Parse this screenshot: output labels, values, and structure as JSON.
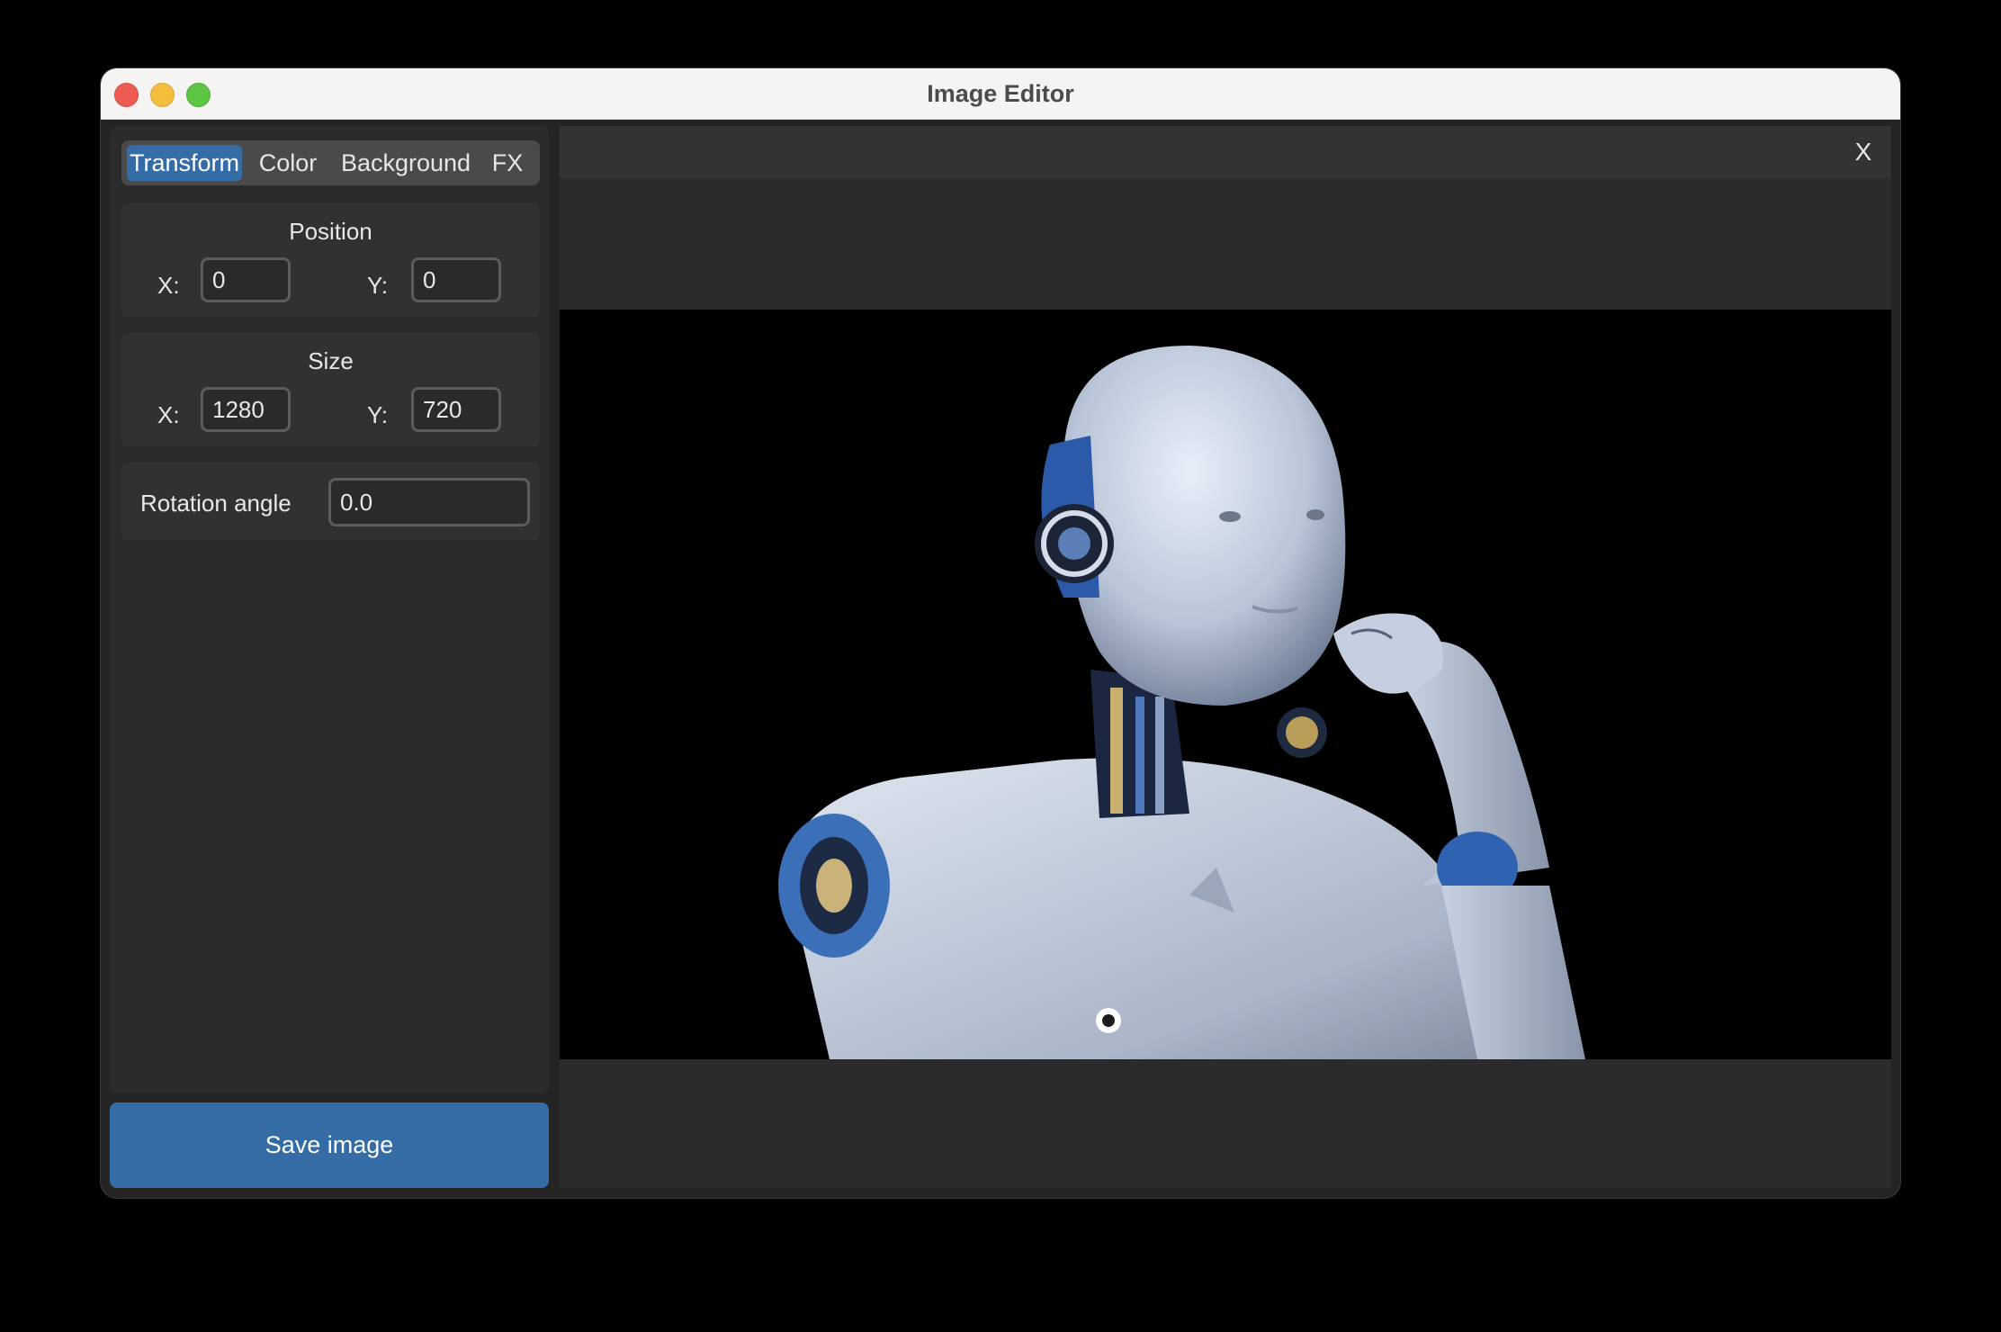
{
  "window": {
    "title": "Image Editor"
  },
  "tabs": [
    {
      "label": "Transform",
      "active": true
    },
    {
      "label": "Color",
      "active": false
    },
    {
      "label": "Background",
      "active": false
    },
    {
      "label": "FX",
      "active": false
    }
  ],
  "position": {
    "title": "Position",
    "x_label": "X:",
    "x_value": "0",
    "y_label": "Y:",
    "y_value": "0"
  },
  "size": {
    "title": "Size",
    "x_label": "X:",
    "x_value": "1280",
    "y_label": "Y:",
    "y_value": "720"
  },
  "rotation": {
    "label": "Rotation angle",
    "value": "0.0"
  },
  "save_label": "Save image",
  "close_label": "X",
  "colors": {
    "accent": "#356ca6",
    "panel": "#2b2b2b",
    "window": "#242424",
    "titlebar": "#f6f4f3"
  }
}
